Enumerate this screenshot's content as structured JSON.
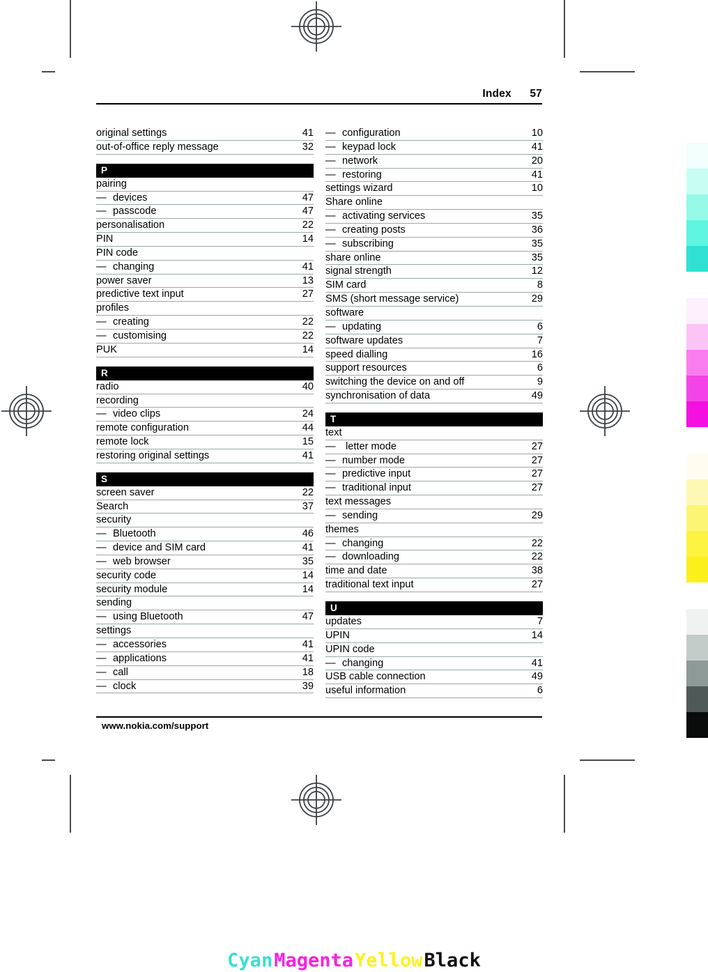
{
  "header": {
    "title": "Index",
    "page_number": "57"
  },
  "footer": {
    "url": "www.nokia.com/support"
  },
  "color_caption": {
    "cyan": "Cyan",
    "magenta": "Magenta",
    "yellow": "Yellow",
    "black": "Black",
    "cyan_color": "#3adfd3",
    "magenta_color": "#f622e0",
    "yellow_color": "#fff01f",
    "black_color": "#111111"
  },
  "color_strip": {
    "groups": [
      {
        "name": "cyan",
        "swatches": [
          "#f1fefc",
          "#c8fdf3",
          "#95fae8",
          "#5ff5e0",
          "#2fe1d2"
        ]
      },
      {
        "name": "magenta",
        "swatches": [
          "#fdeffb",
          "#fcc4f6",
          "#fa7df0",
          "#f444e8",
          "#f310e0"
        ]
      },
      {
        "name": "yellow",
        "swatches": [
          "#fffdf0",
          "#fdf9b4",
          "#fcf573",
          "#fdf23f",
          "#fcf01c"
        ]
      },
      {
        "name": "black",
        "swatches": [
          "#f0f1f1",
          "#c3cbc8",
          "#8d9a97",
          "#4f5a58",
          "#0a0c0b"
        ]
      }
    ]
  },
  "index": {
    "left_column": [
      {
        "type": "entry",
        "term": "original settings",
        "page": "41"
      },
      {
        "type": "entry",
        "term": "out-of-office reply message",
        "page": "32"
      },
      {
        "type": "heading",
        "letter": "P"
      },
      {
        "type": "entry",
        "term": "pairing",
        "page": ""
      },
      {
        "type": "sub",
        "term": "devices",
        "page": "47"
      },
      {
        "type": "sub",
        "term": "passcode",
        "page": "47"
      },
      {
        "type": "entry",
        "term": "personalisation",
        "page": "22"
      },
      {
        "type": "entry",
        "term": "PIN",
        "page": "14"
      },
      {
        "type": "entry",
        "term": "PIN code",
        "page": ""
      },
      {
        "type": "sub",
        "term": "changing",
        "page": "41"
      },
      {
        "type": "entry",
        "term": "power saver",
        "page": "13"
      },
      {
        "type": "entry",
        "term": "predictive text input",
        "page": "27"
      },
      {
        "type": "entry",
        "term": "profiles",
        "page": ""
      },
      {
        "type": "sub",
        "term": "creating",
        "page": "22"
      },
      {
        "type": "sub",
        "term": "customising",
        "page": "22"
      },
      {
        "type": "entry",
        "term": "PUK",
        "page": "14"
      },
      {
        "type": "heading",
        "letter": "R"
      },
      {
        "type": "entry",
        "term": "radio",
        "page": "40"
      },
      {
        "type": "entry",
        "term": "recording",
        "page": ""
      },
      {
        "type": "sub",
        "term": "video clips",
        "page": "24"
      },
      {
        "type": "entry",
        "term": "remote configuration",
        "page": "44"
      },
      {
        "type": "entry",
        "term": "remote lock",
        "page": "15"
      },
      {
        "type": "entry",
        "term": "restoring original settings",
        "page": "41"
      },
      {
        "type": "heading",
        "letter": "S"
      },
      {
        "type": "entry",
        "term": "screen saver",
        "page": "22"
      },
      {
        "type": "entry",
        "term": "Search",
        "page": "37"
      },
      {
        "type": "entry",
        "term": "security",
        "page": ""
      },
      {
        "type": "sub",
        "term": "Bluetooth",
        "page": "46"
      },
      {
        "type": "sub",
        "term": "device and SIM card",
        "page": "41"
      },
      {
        "type": "sub",
        "term": "web browser",
        "page": "35"
      },
      {
        "type": "entry",
        "term": "security code",
        "page": "14"
      },
      {
        "type": "entry",
        "term": "security module",
        "page": "14"
      },
      {
        "type": "entry",
        "term": "sending",
        "page": ""
      },
      {
        "type": "sub",
        "term": "using Bluetooth",
        "page": "47"
      },
      {
        "type": "entry",
        "term": "settings",
        "page": ""
      },
      {
        "type": "sub",
        "term": "accessories",
        "page": "41"
      },
      {
        "type": "sub",
        "term": "applications",
        "page": "41"
      },
      {
        "type": "sub",
        "term": "call",
        "page": "18"
      },
      {
        "type": "sub",
        "term": "clock",
        "page": "39"
      }
    ],
    "right_column": [
      {
        "type": "sub",
        "term": "configuration",
        "page": "10"
      },
      {
        "type": "sub",
        "term": "keypad lock",
        "page": "41"
      },
      {
        "type": "sub",
        "term": "network",
        "page": "20"
      },
      {
        "type": "sub",
        "term": "restoring",
        "page": "41"
      },
      {
        "type": "entry",
        "term": "settings wizard",
        "page": "10"
      },
      {
        "type": "entry",
        "term": "Share online",
        "page": ""
      },
      {
        "type": "sub",
        "term": "activating services",
        "page": "35"
      },
      {
        "type": "sub",
        "term": "creating posts",
        "page": "36"
      },
      {
        "type": "sub",
        "term": "subscribing",
        "page": "35"
      },
      {
        "type": "entry",
        "term": "share online",
        "page": "35"
      },
      {
        "type": "entry",
        "term": "signal strength",
        "page": "12"
      },
      {
        "type": "entry",
        "term": "SIM card",
        "page": "8"
      },
      {
        "type": "entry",
        "term": "SMS (short message service)",
        "page": "29"
      },
      {
        "type": "entry",
        "term": "software",
        "page": ""
      },
      {
        "type": "sub",
        "term": "updating",
        "page": "6"
      },
      {
        "type": "entry",
        "term": "software updates",
        "page": "7"
      },
      {
        "type": "entry",
        "term": "speed dialling",
        "page": "16"
      },
      {
        "type": "entry",
        "term": "support resources",
        "page": "6"
      },
      {
        "type": "entry",
        "term": "switching the device on and off",
        "page": "9"
      },
      {
        "type": "entry",
        "term": "synchronisation of data",
        "page": "49"
      },
      {
        "type": "heading",
        "letter": "T"
      },
      {
        "type": "entry",
        "term": "text",
        "page": ""
      },
      {
        "type": "sub",
        "term": "letter mode",
        "page": "27",
        "wide_dash": true
      },
      {
        "type": "sub",
        "term": "number mode",
        "page": "27"
      },
      {
        "type": "sub",
        "term": "predictive input",
        "page": "27"
      },
      {
        "type": "sub",
        "term": "traditional input",
        "page": "27"
      },
      {
        "type": "entry",
        "term": "text messages",
        "page": ""
      },
      {
        "type": "sub",
        "term": "sending",
        "page": "29"
      },
      {
        "type": "entry",
        "term": "themes",
        "page": ""
      },
      {
        "type": "sub",
        "term": "changing",
        "page": "22"
      },
      {
        "type": "sub",
        "term": "downloading",
        "page": "22"
      },
      {
        "type": "entry",
        "term": "time and date",
        "page": "38"
      },
      {
        "type": "entry",
        "term": "traditional text input",
        "page": "27"
      },
      {
        "type": "heading",
        "letter": "U"
      },
      {
        "type": "entry",
        "term": "updates",
        "page": "7"
      },
      {
        "type": "entry",
        "term": "UPIN",
        "page": "14"
      },
      {
        "type": "entry",
        "term": "UPIN code",
        "page": ""
      },
      {
        "type": "sub",
        "term": "changing",
        "page": "41"
      },
      {
        "type": "entry",
        "term": "USB cable connection",
        "page": "49"
      },
      {
        "type": "entry",
        "term": "useful information",
        "page": "6"
      }
    ]
  }
}
